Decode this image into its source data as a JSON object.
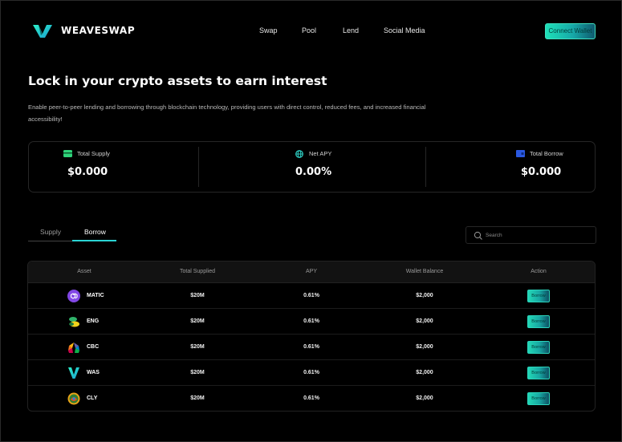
{
  "header": {
    "brand": "WEAVESWAP",
    "nav": [
      "Swap",
      "Pool",
      "Lend",
      "Social Media"
    ],
    "connect_label": "Connect Wallet"
  },
  "hero": {
    "title": "Lock in your crypto assets to earn interest",
    "description": "Enable peer-to-peer lending and borrowing through blockchain technology, providing users with direct control, reduced fees, and increased financial accessibility!"
  },
  "stats": [
    {
      "label": "Total Supply",
      "value": "$0.000",
      "icon": "wallet-icon"
    },
    {
      "label": "Net APY",
      "value": "0.00%",
      "icon": "globe-icon"
    },
    {
      "label": "Total Borrow",
      "value": "$0.000",
      "icon": "card-icon"
    }
  ],
  "tabs": [
    {
      "label": "Supply",
      "active": false
    },
    {
      "label": "Borrow",
      "active": true
    }
  ],
  "search": {
    "placeholder": "Search"
  },
  "table": {
    "columns": [
      "Asset",
      "Total Supplied",
      "APY",
      "Wallet Balance",
      "Action"
    ],
    "rows": [
      {
        "asset": "MATIC",
        "icon": "matic-icon",
        "supplied": "$20M",
        "apy": "0.61%",
        "balance": "$2,000",
        "action": "Borrow"
      },
      {
        "asset": "ENG",
        "icon": "eng-icon",
        "supplied": "$20M",
        "apy": "0.61%",
        "balance": "$2,000",
        "action": "Borrow"
      },
      {
        "asset": "CBC",
        "icon": "cbc-icon",
        "supplied": "$20M",
        "apy": "0.61%",
        "balance": "$2,000",
        "action": "Borrow"
      },
      {
        "asset": "WAS",
        "icon": "was-icon",
        "supplied": "$20M",
        "apy": "0.61%",
        "balance": "$2,000",
        "action": "Borrow"
      },
      {
        "asset": "CLY",
        "icon": "cly-icon",
        "supplied": "$20M",
        "apy": "0.61%",
        "balance": "$2,000",
        "action": "Borrow"
      }
    ]
  },
  "colors": {
    "accent": "#1ee0b8",
    "background": "#000000",
    "active_tab_line": "#2ad4d4"
  }
}
